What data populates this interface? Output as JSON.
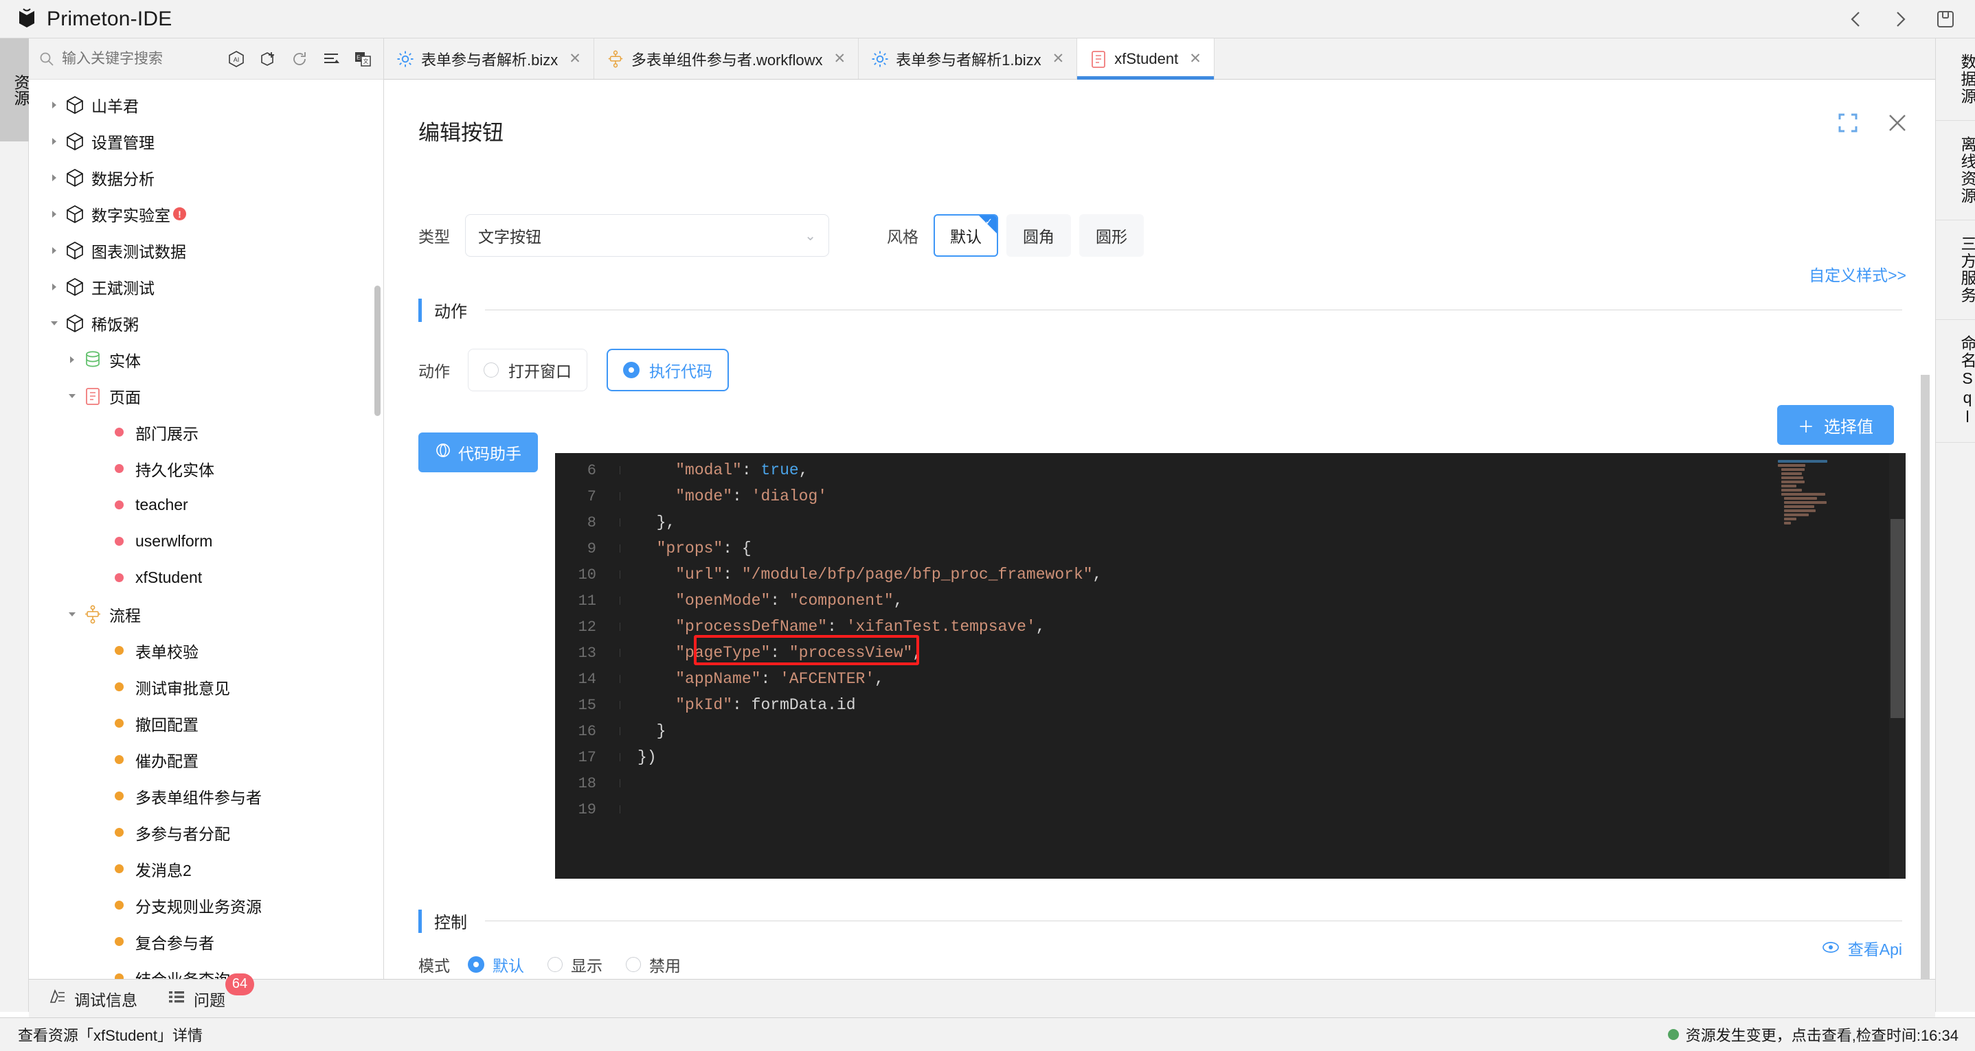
{
  "window": {
    "app_title": "Primeton-IDE",
    "logo_icon": "primeton-logo-icon",
    "nav_back_icon": "chevron-left-icon",
    "nav_forward_icon": "chevron-right-icon",
    "save_icon": "save-disk-icon"
  },
  "left_rail": {
    "tab_label": "资源"
  },
  "sidebar": {
    "search": {
      "placeholder": "输入关键字搜索",
      "value": "",
      "icon": "search-icon"
    },
    "tools": [
      {
        "name": "ai-icon",
        "glyph": "AI"
      },
      {
        "name": "add-package-icon",
        "glyph": "＋"
      },
      {
        "name": "refresh-icon",
        "glyph": "⟳"
      },
      {
        "name": "sort-icon",
        "glyph": "≡"
      },
      {
        "name": "translate-icon",
        "glyph": "En"
      }
    ],
    "tree": [
      {
        "label": "山羊君",
        "level": 0,
        "icon": "package-icon",
        "arrow": "collapsed"
      },
      {
        "label": "设置管理",
        "level": 0,
        "icon": "package-icon",
        "arrow": "collapsed"
      },
      {
        "label": "数据分析",
        "level": 0,
        "icon": "package-icon",
        "arrow": "collapsed"
      },
      {
        "label": "数字实验室",
        "level": 0,
        "icon": "package-icon",
        "arrow": "collapsed",
        "badge": "!"
      },
      {
        "label": "图表测试数据",
        "level": 0,
        "icon": "package-icon",
        "arrow": "collapsed"
      },
      {
        "label": "王斌测试",
        "level": 0,
        "icon": "package-icon",
        "arrow": "collapsed"
      },
      {
        "label": "稀饭粥",
        "level": 0,
        "icon": "package-icon",
        "arrow": "expanded"
      },
      {
        "label": "实体",
        "level": 1,
        "icon": "database-icon",
        "arrow": "collapsed"
      },
      {
        "label": "页面",
        "level": 1,
        "icon": "page-icon",
        "arrow": "expanded"
      },
      {
        "label": "部门展示",
        "level": 2,
        "icon": "dot-red"
      },
      {
        "label": "持久化实体",
        "level": 2,
        "icon": "dot-red"
      },
      {
        "label": "teacher",
        "level": 2,
        "icon": "dot-red"
      },
      {
        "label": "userwlform",
        "level": 2,
        "icon": "dot-red"
      },
      {
        "label": "xfStudent",
        "level": 2,
        "icon": "dot-red"
      },
      {
        "label": "流程",
        "level": 1,
        "icon": "workflow-icon",
        "arrow": "expanded"
      },
      {
        "label": "表单校验",
        "level": 2,
        "icon": "dot-orange"
      },
      {
        "label": "测试审批意见",
        "level": 2,
        "icon": "dot-orange"
      },
      {
        "label": "撤回配置",
        "level": 2,
        "icon": "dot-orange"
      },
      {
        "label": "催办配置",
        "level": 2,
        "icon": "dot-orange"
      },
      {
        "label": "多表单组件参与者",
        "level": 2,
        "icon": "dot-orange"
      },
      {
        "label": "多参与者分配",
        "level": 2,
        "icon": "dot-orange"
      },
      {
        "label": "发消息2",
        "level": 2,
        "icon": "dot-orange"
      },
      {
        "label": "分支规则业务资源",
        "level": 2,
        "icon": "dot-orange"
      },
      {
        "label": "复合参与者",
        "level": 2,
        "icon": "dot-orange"
      },
      {
        "label": "结合业务查询",
        "level": 2,
        "icon": "dot-orange"
      }
    ]
  },
  "editor_tabs": [
    {
      "label": "表单参与者解析.bizx",
      "icon": "gear-blue-icon",
      "active": false
    },
    {
      "label": "多表单组件参与者.workflowx",
      "icon": "workflow-icon",
      "active": false
    },
    {
      "label": "表单参与者解析1.bizx",
      "icon": "gear-blue-icon",
      "active": false
    },
    {
      "label": "xfStudent",
      "icon": "page-red-icon",
      "active": true
    }
  ],
  "dialog": {
    "title": "编辑按钮",
    "expand_icon": "expand-icon",
    "close_icon": "close-icon",
    "type_label": "类型",
    "type_value": "文字按钮",
    "style_label": "风格",
    "style_options": [
      {
        "label": "默认",
        "selected": true
      },
      {
        "label": "圆角",
        "selected": false
      },
      {
        "label": "圆形",
        "selected": false
      }
    ],
    "custom_style_link": "自定义样式>>",
    "action_section_title": "动作",
    "action_label": "动作",
    "action_options": [
      {
        "label": "打开窗口",
        "selected": false
      },
      {
        "label": "执行代码",
        "selected": true
      }
    ],
    "pick_value_button": "选择值",
    "pick_value_icon": "plus-icon",
    "code_assistant_button": "代码助手",
    "code_assistant_icon": "assistant-icon",
    "control_section_title": "控制",
    "mode_label": "模式",
    "mode_options": [
      {
        "label": "默认",
        "selected": true
      },
      {
        "label": "显示",
        "selected": false
      },
      {
        "label": "禁用",
        "selected": false
      }
    ],
    "view_api_link": "查看Api",
    "view_api_icon": "eye-icon"
  },
  "code_editor": {
    "first_visible_line": 6,
    "lines": [
      {
        "n": 6,
        "text": "    \"modal\": true,"
      },
      {
        "n": 7,
        "text": "    \"mode\": 'dialog'"
      },
      {
        "n": 8,
        "text": "  },"
      },
      {
        "n": 9,
        "text": "  \"props\": {"
      },
      {
        "n": 10,
        "text": "    \"url\": \"/module/bfp/page/bfp_proc_framework\","
      },
      {
        "n": 11,
        "text": "    \"openMode\": \"component\","
      },
      {
        "n": 12,
        "text": "    \"processDefName\": 'xifanTest.tempsave',"
      },
      {
        "n": 13,
        "text": "    \"pageType\": \"processView\","
      },
      {
        "n": 14,
        "text": "    \"appName\": 'AFCENTER',"
      },
      {
        "n": 15,
        "text": "    \"pkId\": formData.id"
      },
      {
        "n": 16,
        "text": "  }"
      },
      {
        "n": 17,
        "text": "})"
      },
      {
        "n": 18,
        "text": ""
      },
      {
        "n": 19,
        "text": ""
      }
    ],
    "highlighted_line": 13
  },
  "right_rail": [
    {
      "label": "数据源"
    },
    {
      "label": "离线资源"
    },
    {
      "label": "三方服务"
    },
    {
      "label": "命名Sql"
    }
  ],
  "bottom_bar": [
    {
      "label": "调试信息",
      "icon": "debug-icon"
    },
    {
      "label": "问题",
      "icon": "list-icon",
      "badge": "64"
    }
  ],
  "status_bar": {
    "left_text": "查看资源「xfStudent」详情",
    "right_text": "资源发生变更，点击查看,检查时间:16:34",
    "right_dot_color": "#53a461"
  },
  "colors": {
    "accent": "#3f97f6",
    "accent_button": "#4ba0f7",
    "highlight_box": "#ff1d1d",
    "dot_red": "#f4697a",
    "dot_orange": "#f0a02e",
    "editor_bg": "#1f1f1f"
  }
}
